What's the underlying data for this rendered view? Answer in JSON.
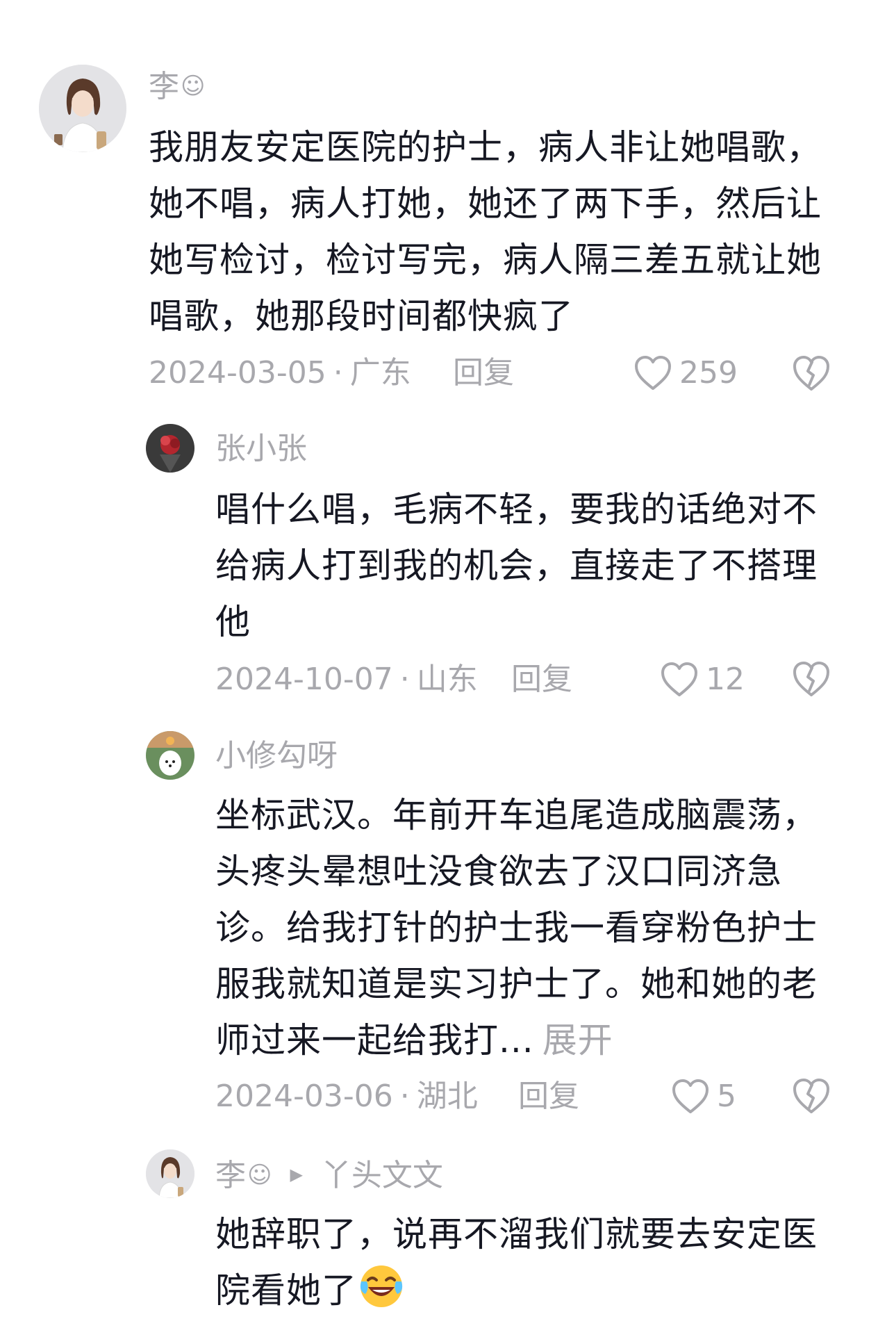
{
  "comments": [
    {
      "username": "李",
      "username_emoji": "☺",
      "text": "我朋友安定医院的护士，病人非让她唱歌，她不唱，病人打她，她还了两下手，然后让她写检讨，检讨写完，病人隔三差五就让她唱歌，她那段时间都快疯了",
      "date": "2024-03-05",
      "location": "广东",
      "reply_label": "回复",
      "likes": "259"
    },
    {
      "username": "张小张",
      "text": "唱什么唱，毛病不轻，要我的话绝对不给病人打到我的机会，直接走了不搭理他",
      "date": "2024-10-07",
      "location": "山东",
      "reply_label": "回复",
      "likes": "12"
    },
    {
      "username": "小修勾呀",
      "text": "坐标武汉。年前开车追尾造成脑震荡，头疼头晕想吐没食欲去了汉口同济急诊。给我打针的护士我一看穿粉色护士服我就知道是实习护士了。她和她的老师过来一起给我打...",
      "expand_label": "展开",
      "date": "2024-03-06",
      "location": "湖北",
      "reply_label": "回复",
      "likes": "5"
    },
    {
      "username": "李",
      "username_emoji": "☺",
      "reply_to": "丫头文文",
      "text": "她辞职了，说再不溜我们就要去安定医院看她了"
    }
  ],
  "icons": {
    "like": "heart-outline-icon",
    "dislike": "broken-heart-icon",
    "reply_arrow": "triangle-right-icon",
    "emoji": "laughing-tears-emoji"
  },
  "colors": {
    "text": "#161823",
    "meta": "#a8a8ad",
    "background": "#ffffff"
  }
}
